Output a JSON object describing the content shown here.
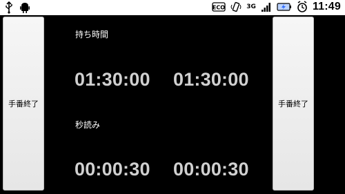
{
  "status_bar": {
    "network_label": "3G",
    "time": "11:49",
    "icons": [
      "usb-icon",
      "android-icon",
      "eco-icon",
      "vibrate-icon",
      "signal-icon",
      "battery-icon",
      "alarm-icon"
    ]
  },
  "buttons": {
    "left_label": "手番終了",
    "right_label": "手番終了"
  },
  "sections": {
    "remaining_time_label": "持ち時間",
    "byoyomi_label": "秒読み"
  },
  "clocks": {
    "player1_remaining": "01:30:00",
    "player2_remaining": "01:30:00",
    "player1_byoyomi": "00:00:30",
    "player2_byoyomi": "00:00:30"
  }
}
